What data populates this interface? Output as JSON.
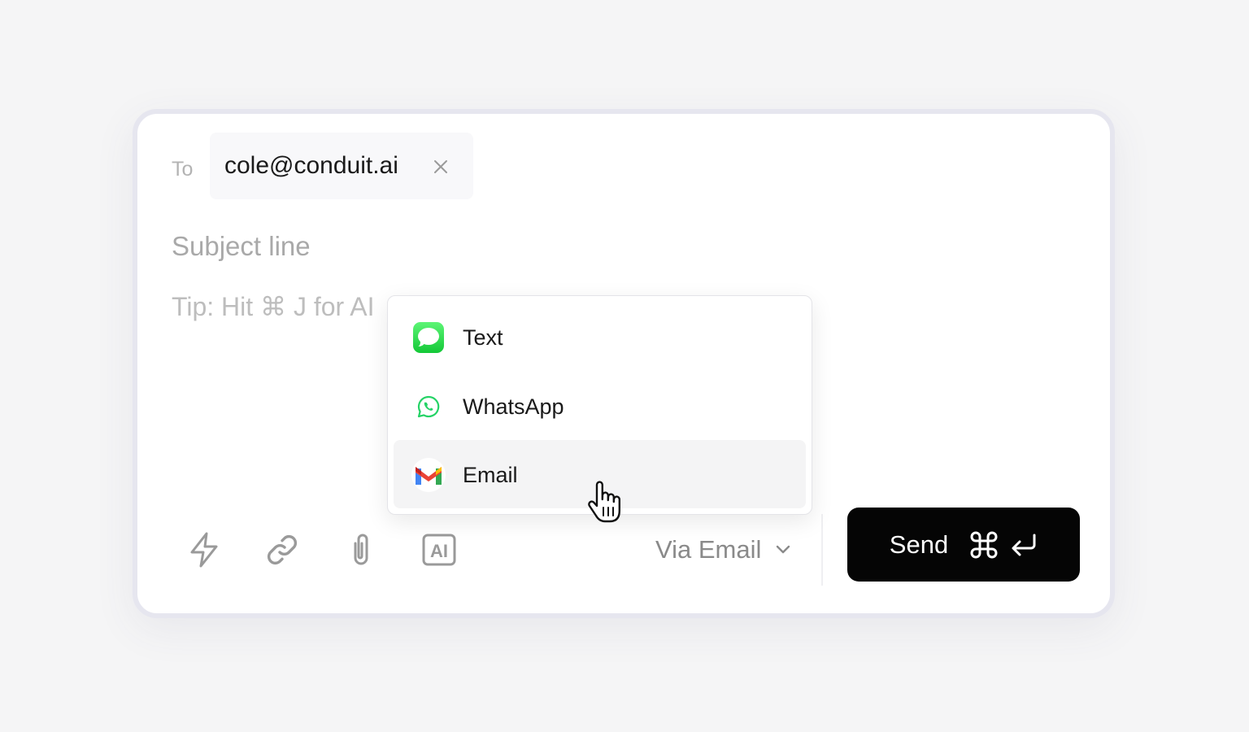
{
  "recipient": {
    "label": "To",
    "address": "cole@conduit.ai"
  },
  "subject": {
    "placeholder": "Subject line"
  },
  "body": {
    "tip": "Tip: Hit ⌘ J for AI"
  },
  "toolbar": {
    "icons": [
      "bolt-icon",
      "link-icon",
      "paperclip-icon",
      "ai-icon"
    ],
    "ai_icon_text": "AI"
  },
  "channel": {
    "selected_label": "Via Email"
  },
  "send": {
    "label": "Send",
    "shortcut": [
      "⌘",
      "↵"
    ]
  },
  "dropdown": {
    "items": [
      {
        "label": "Text",
        "icon": "messages-icon",
        "active": false
      },
      {
        "label": "WhatsApp",
        "icon": "whatsapp-icon",
        "active": false
      },
      {
        "label": "Email",
        "icon": "gmail-icon",
        "active": true
      }
    ]
  },
  "colors": {
    "send_background": "#050505",
    "messages_green": "#34c759",
    "whatsapp_green": "#25d366",
    "gmail_red": "#ea4335",
    "gmail_blue": "#4285f4",
    "gmail_green": "#34a853",
    "gmail_yellow": "#fbbc04"
  }
}
